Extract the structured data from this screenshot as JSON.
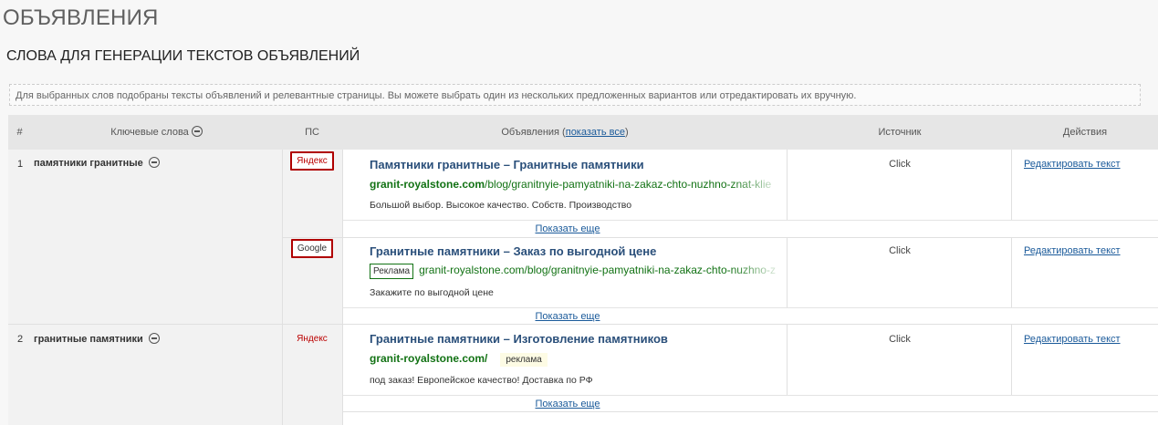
{
  "page": {
    "title": "ОБЪЯВЛЕНИЯ",
    "section_title": "СЛОВА ДЛЯ ГЕНЕРАЦИИ ТЕКСТОВ ОБЪЯВЛЕНИЙ"
  },
  "info": "Для выбранных слов подобраны тексты объявлений и релевантные страницы. Вы можете выбрать один из нескольких предложенных вариантов или отредактировать их вручную.",
  "table": {
    "headers": {
      "num": "#",
      "keywords": "Ключевые слова",
      "ps": "ПС",
      "ads_prefix": "Объявления (",
      "ads_link": "показать все",
      "ads_suffix": ")",
      "source": "Источник",
      "actions": "Действия"
    },
    "rows": [
      {
        "num": "1",
        "keyword": "памятники гранитные",
        "ads": [
          {
            "ps": "Яндекс",
            "title": "Памятники гранитные – Гранитные памятники",
            "url_bold": "granit-royalstone.com",
            "url_rest": "/blog/granitnyie-pamyatniki-na-zakaz-chto-nuzhno-znat-kliе",
            "desc": "Большой выбор. Высокое качество. Собств. Производство",
            "source": "Click",
            "action": "Редактировать текст",
            "more": "Показать еще"
          },
          {
            "ps": "Google",
            "badge": "Реклама",
            "title": "Гранитные памятники – Заказ по выгодной цене",
            "url_rest": "granit-royalstone.com/blog/granitnyie-pamyatniki-na-zakaz-chto-nuzhno-z",
            "desc": "Закажите по выгодной цене",
            "source": "Click",
            "action": "Редактировать текст",
            "more": "Показать еще"
          }
        ]
      },
      {
        "num": "2",
        "keyword": "гранитные памятники",
        "ads": [
          {
            "ps": "Яндекс",
            "title": "Гранитные памятники – Изготовление памятников",
            "url_bold": "granit-royalstone.com/",
            "tag": "реклама",
            "desc": "под заказ! Европейское качество! Доставка по РФ",
            "source": "Click",
            "action": "Редактировать текст",
            "more": "Показать еще"
          }
        ]
      }
    ]
  },
  "colors": {
    "header_bg": "#e6e6e6",
    "link": "#1a5a9a",
    "url_green": "#127214",
    "ad_title": "#2a4f7a",
    "highlight": "#b00000"
  }
}
